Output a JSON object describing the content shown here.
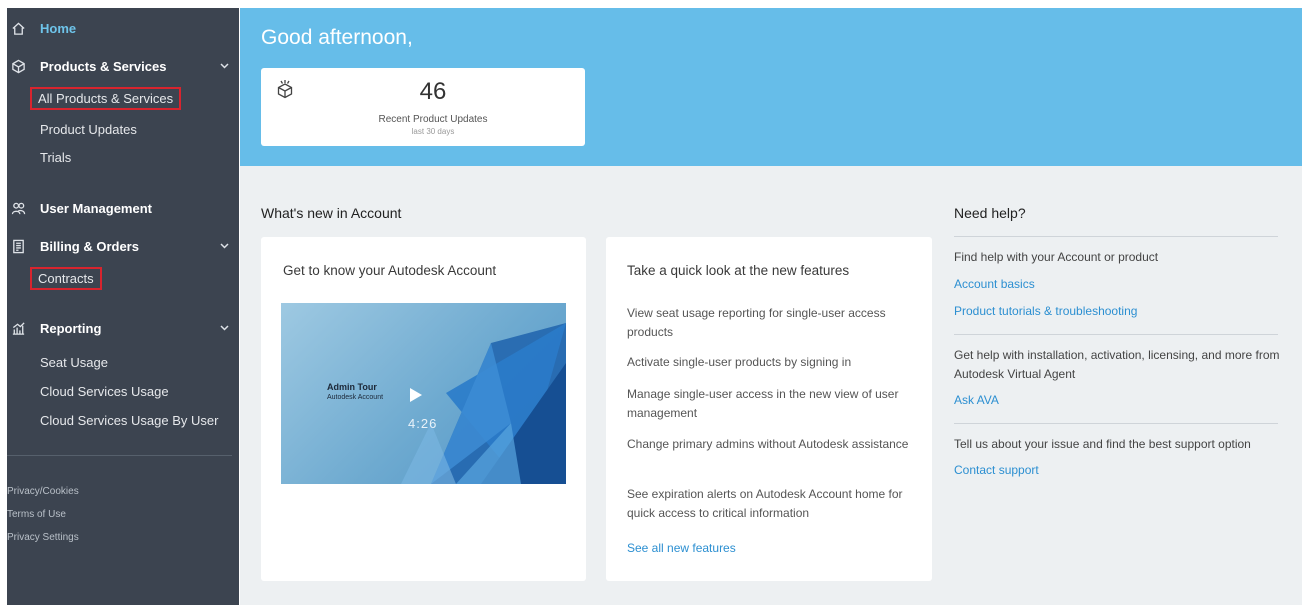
{
  "sidebar": {
    "home": {
      "label": "Home",
      "icon": "home-icon"
    },
    "products": {
      "label": "Products & Services",
      "icon": "box-icon",
      "items": [
        "All Products & Services",
        "Product Updates",
        "Trials"
      ]
    },
    "user_management": {
      "label": "User Management",
      "icon": "users-icon"
    },
    "billing": {
      "label": "Billing & Orders",
      "icon": "billing-icon",
      "items": [
        "Contracts"
      ]
    },
    "reporting": {
      "label": "Reporting",
      "icon": "reporting-icon",
      "items": [
        "Seat Usage",
        "Cloud Services Usage",
        "Cloud Services Usage By User"
      ]
    },
    "footer": [
      "Privacy/Cookies",
      "Terms of Use",
      "Privacy Settings"
    ]
  },
  "hero": {
    "greeting": "Good afternoon,",
    "updates": {
      "count": "46",
      "label": "Recent Product Updates",
      "sub": "last 30 days"
    }
  },
  "whats_new": {
    "title": "What's new in Account",
    "video_card": {
      "heading": "Get to know your Autodesk Account",
      "video_title": "Admin Tour",
      "video_sub": "Autodesk Account",
      "duration": "4:26"
    },
    "features_card": {
      "heading": "Take a quick look at the new features",
      "items": [
        "View seat usage reporting for single-user access products",
        "Activate single-user products by signing in",
        "Manage single-user access in the new view of user management",
        "Change primary admins without Autodesk assistance",
        "See expiration alerts on Autodesk Account home for quick access to critical information"
      ],
      "link": "See all new features"
    }
  },
  "help": {
    "title": "Need help?",
    "text1": "Find help with your Account or product",
    "link1": "Account basics",
    "link2": "Product tutorials & troubleshooting",
    "text2": "Get help with installation, activation, licensing, and more from Autodesk Virtual Agent",
    "link3": "Ask AVA",
    "text3": "Tell us about your issue and find the best support option",
    "link4": "Contact support"
  },
  "colors": {
    "sidebar_bg": "#3c4450",
    "hero_bg": "#66bde9",
    "content_bg": "#edf0f2",
    "link": "#2c8fd1",
    "highlight_outline": "#d8242e"
  }
}
